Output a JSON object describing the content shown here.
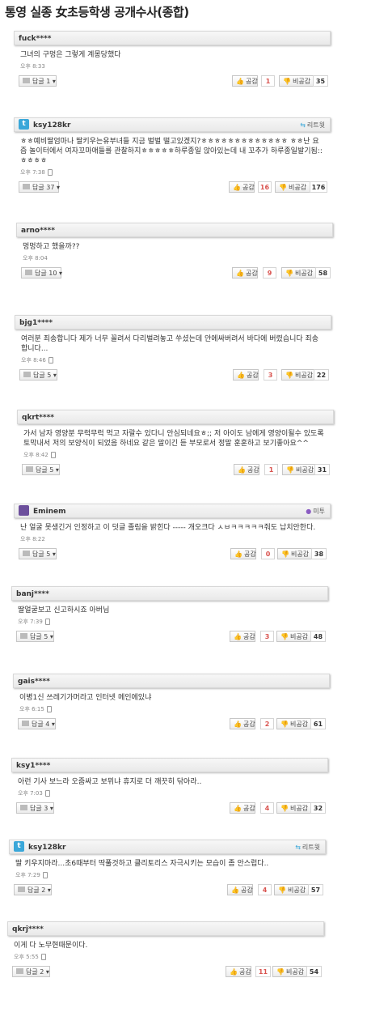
{
  "page": {
    "title": "통영 실종 女초등학생 공개수사(종합)"
  },
  "labels": {
    "reply": "답글",
    "like": "공감",
    "dislike": "비공감"
  },
  "comments": [
    {
      "author": "fuck****",
      "source": null,
      "text": "그녀의 구멍은 그렇게 계몽당했다",
      "time": "오후 8:33",
      "replies": "1",
      "like": "1",
      "total": "35"
    },
    {
      "author": "ksy128kr",
      "source": "리트윗",
      "text": "ㅎㅎ예비딸엄마나 딸키우는유부녀들 지금 벌벌 떨고있겠지?ㅎㅎㅎㅎㅎㅎㅎㅎㅎㅎㅎㅎㅎ ㅎㅎ난 요즘 놀이터에서 여자꼬마애들를 관찰하지ㅎㅎㅎㅎㅎ하루종일 앉아있는데 내 꼬추가 하루종일발기됨:: ㅎㅎㅎㅎ",
      "time": "오후 7:38",
      "replies": "37",
      "like": "16",
      "total": "176"
    },
    {
      "author": "arno****",
      "source": null,
      "text": "멍멍하고 했을까??",
      "time": "오후 8:04",
      "replies": "10",
      "like": "9",
      "total": "58"
    },
    {
      "author": "bjg1****",
      "source": null,
      "text": "여러분 죄송합니다 제가 너무 꼴려서 다리벌려놓고 쑤셨는데 안에싸버려서 바다에 버렸습니다 죄송합니다...",
      "time": "오후 8:46",
      "replies": "5",
      "like": "3",
      "total": "22"
    },
    {
      "author": "qkrt****",
      "source": null,
      "text": "가서 남자 영양분 무럭무럭 먹고 자랄수 있다니 안심되네요ㅎ;; 저 아이도 남에게 영양이될수 있도록 토막내서 저의 보양식이 되었음 하네요 같은 말이긴 듣 부모로서 정말 훈훈하고 보기좋아요^^",
      "time": "오후 8:42",
      "replies": "5",
      "like": "1",
      "total": "31"
    },
    {
      "author": "Eminem",
      "source": "미투",
      "text": "난 얼굴 못생긴거 인정하고 이 덧글 졸림을 밝힌다 ----- 개오크다 ㅅㅂㅋㅋㅋㅋㅋ줘도 납치안한다.",
      "time": "오후 8:22",
      "replies": "5",
      "like": "0",
      "total": "38"
    },
    {
      "author": "banj****",
      "source": null,
      "text": "딸얼굴보고 신고하시죠 아버님",
      "time": "오후 7:39",
      "replies": "5",
      "like": "3",
      "total": "48"
    },
    {
      "author": "gais****",
      "source": null,
      "text": "이병1신 쓰레기가머라고 인터넷 메인에있냐",
      "time": "오후 6:15",
      "replies": "4",
      "like": "2",
      "total": "61"
    },
    {
      "author": "ksy1****",
      "source": null,
      "text": "아런 기사 보느라 오줌싸고 보뮈냐 휴지로 더 깨끗히 닦아라..",
      "time": "오후 7:03",
      "replies": "3",
      "like": "4",
      "total": "32"
    },
    {
      "author": "ksy128kr",
      "source": "리트윗",
      "text": "딸 키우지마라...초6때부터 딱풀것하고 클리토리스 자극시키는 모습이 좀 안스럽다..",
      "time": "오후 7:29",
      "replies": "2",
      "like": "4",
      "total": "57"
    },
    {
      "author": "qkrj****",
      "source": null,
      "text": "이게 다 노무현때문이다.",
      "time": "오후 5:55",
      "replies": "2",
      "like": "11",
      "total": "54"
    }
  ]
}
